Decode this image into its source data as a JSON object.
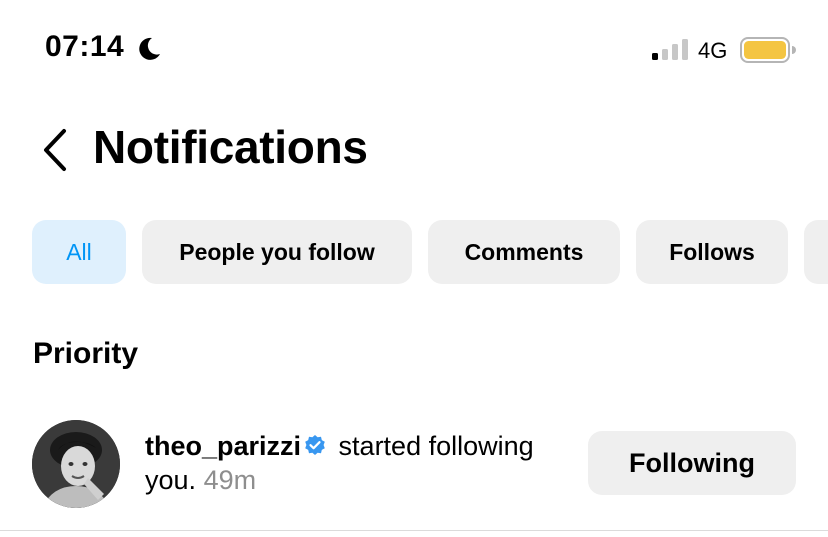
{
  "status_bar": {
    "time": "07:14",
    "network": "4G",
    "battery_color": "#f4c542"
  },
  "header": {
    "title": "Notifications"
  },
  "filters": [
    {
      "label": "All",
      "active": true
    },
    {
      "label": "People you follow",
      "active": false
    },
    {
      "label": "Comments",
      "active": false
    },
    {
      "label": "Follows",
      "active": false
    }
  ],
  "sections": {
    "priority_title": "Priority"
  },
  "notification": {
    "username": "theo_parizzi",
    "action": "started following",
    "action_cont": "you.",
    "time_ago": "49m",
    "button_label": "Following"
  },
  "colors": {
    "accent": "#0095f6",
    "chip_bg": "#efefef",
    "chip_active_bg": "#dff0fd",
    "verified": "#3897f0"
  }
}
